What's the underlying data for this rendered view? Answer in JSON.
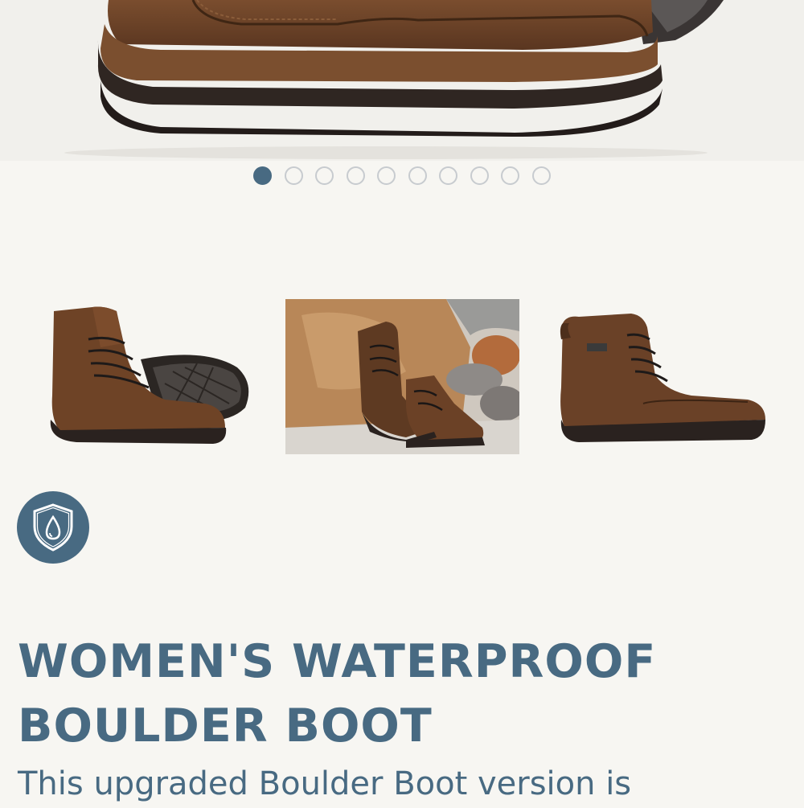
{
  "product": {
    "title": "WOMEN'S WATERPROOF BOULDER BOOT",
    "description": "This upgraded Boulder Boot version is"
  },
  "carousel": {
    "total_slides": 10,
    "active_index": 0
  },
  "thumbnails": [
    {
      "name": "boot-pair-side-view"
    },
    {
      "name": "boots-on-rocks-photo"
    },
    {
      "name": "single-boot-side-view"
    }
  ],
  "badge": {
    "icon": "waterproof-shield-icon"
  },
  "colors": {
    "accent": "#486a82",
    "background": "#f7f6f2",
    "leather": "#6e4326",
    "sole": "#2f2622"
  }
}
